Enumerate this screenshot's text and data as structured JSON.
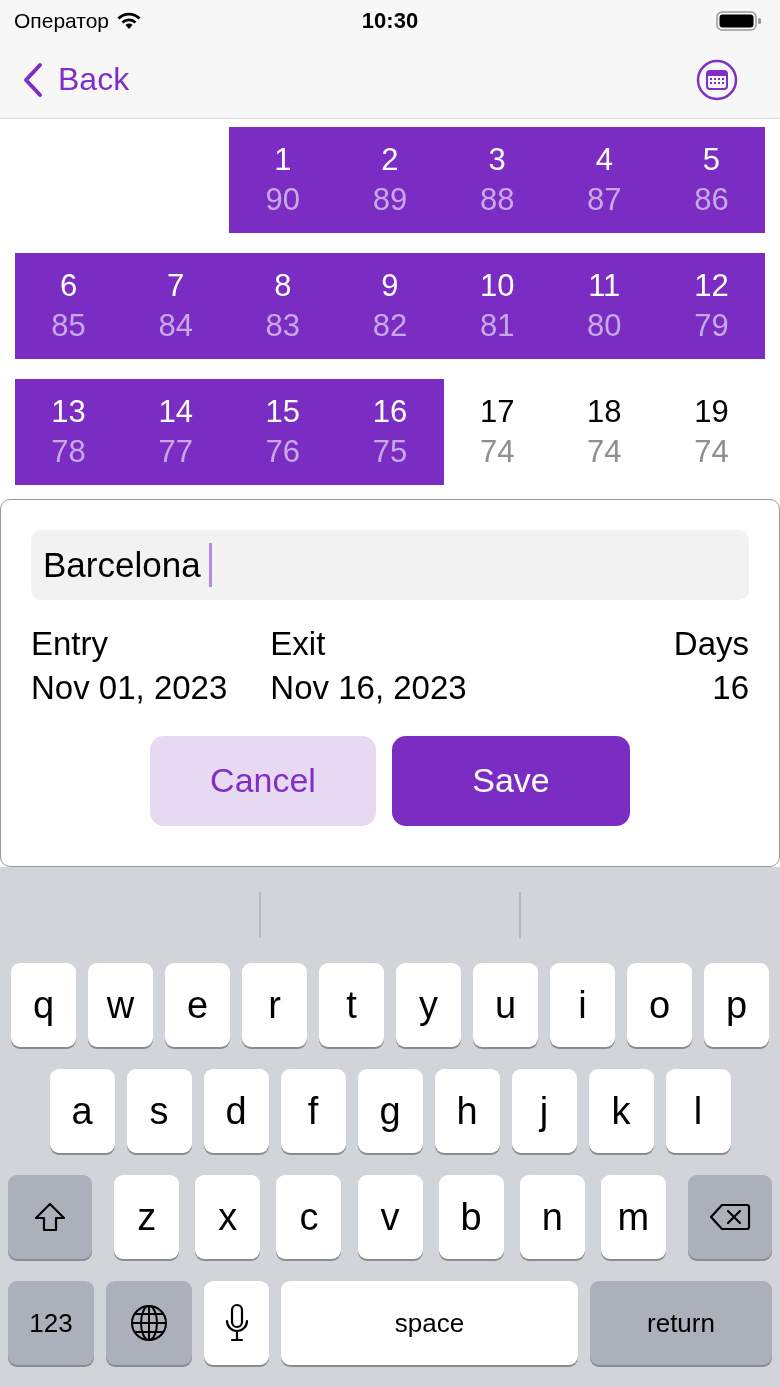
{
  "status_bar": {
    "carrier": "Оператор",
    "time": "10:30"
  },
  "nav": {
    "back": "Back"
  },
  "weeks": [
    {
      "days": [
        {
          "day": "1",
          "count": "90",
          "selected": true
        },
        {
          "day": "2",
          "count": "89",
          "selected": true
        },
        {
          "day": "3",
          "count": "88",
          "selected": true
        },
        {
          "day": "4",
          "count": "87",
          "selected": true
        },
        {
          "day": "5",
          "count": "86",
          "selected": true
        }
      ]
    },
    {
      "days": [
        {
          "day": "6",
          "count": "85",
          "selected": true
        },
        {
          "day": "7",
          "count": "84",
          "selected": true
        },
        {
          "day": "8",
          "count": "83",
          "selected": true
        },
        {
          "day": "9",
          "count": "82",
          "selected": true
        },
        {
          "day": "10",
          "count": "81",
          "selected": true
        },
        {
          "day": "11",
          "count": "80",
          "selected": true
        },
        {
          "day": "12",
          "count": "79",
          "selected": true
        }
      ]
    },
    {
      "days": [
        {
          "day": "13",
          "count": "78",
          "selected": true
        },
        {
          "day": "14",
          "count": "77",
          "selected": true
        },
        {
          "day": "15",
          "count": "76",
          "selected": true
        },
        {
          "day": "16",
          "count": "75",
          "selected": true
        },
        {
          "day": "17",
          "count": "74",
          "selected": false
        },
        {
          "day": "18",
          "count": "74",
          "selected": false
        },
        {
          "day": "19",
          "count": "74",
          "selected": false
        }
      ]
    }
  ],
  "form": {
    "place": "Barcelona",
    "entry_label": "Entry",
    "entry_date": "Nov 01, 2023",
    "exit_label": "Exit",
    "exit_date": "Nov 16, 2023",
    "days_label": "Days",
    "days": "16",
    "cancel": "Cancel",
    "save": "Save"
  },
  "keyboard": {
    "letter_rows": [
      [
        "q",
        "w",
        "e",
        "r",
        "t",
        "y",
        "u",
        "i",
        "o",
        "p"
      ],
      [
        "a",
        "s",
        "d",
        "f",
        "g",
        "h",
        "j",
        "k",
        "l"
      ],
      [
        "z",
        "x",
        "c",
        "v",
        "b",
        "n",
        "m"
      ]
    ],
    "numbers_key": "123",
    "space_key": "space",
    "return_key": "return"
  }
}
